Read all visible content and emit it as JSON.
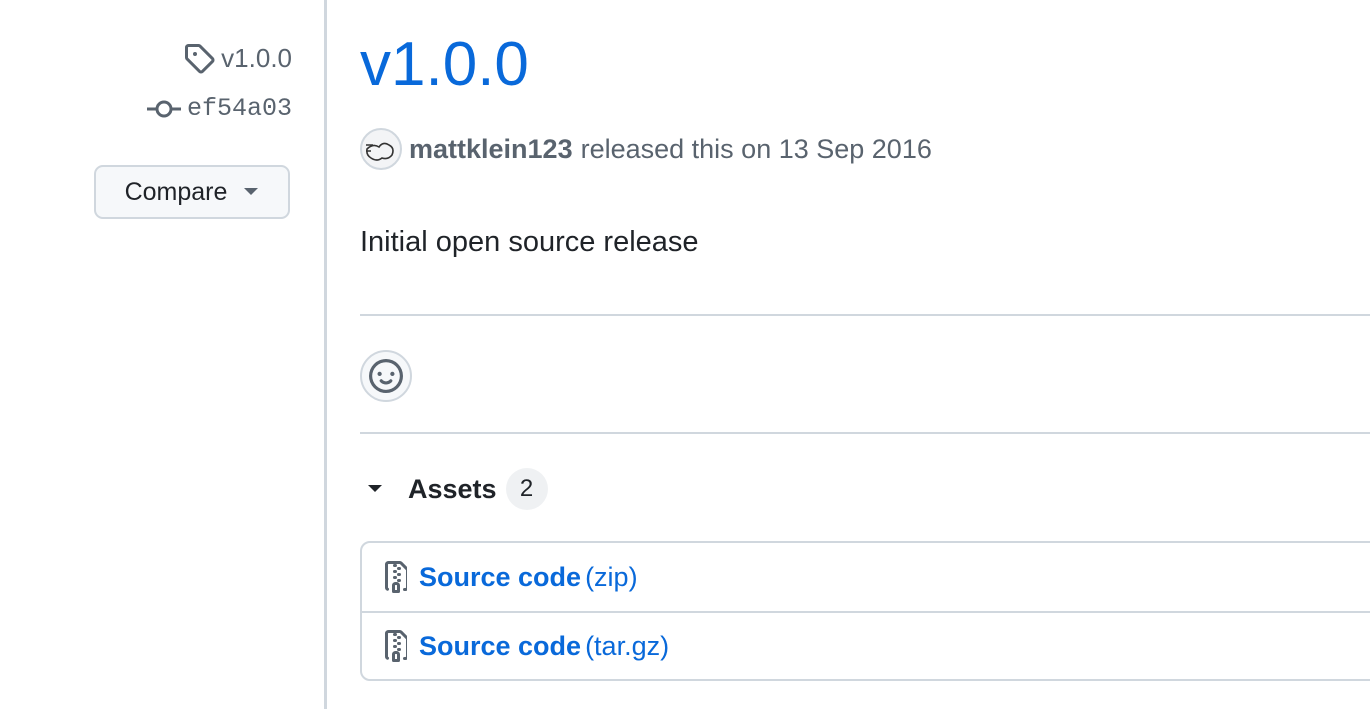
{
  "sidebar": {
    "tag": {
      "label": "v1.0.0",
      "icon": "tag-icon"
    },
    "commit": {
      "label": "ef54a03",
      "icon": "git-commit-icon"
    },
    "compare_button": {
      "label": "Compare",
      "icon": "triangle-down-icon"
    }
  },
  "release": {
    "title": "v1.0.0",
    "author": "mattklein123",
    "released_text": "released this on 13 Sep 2016",
    "notes": "Initial open source release"
  },
  "reactions": {
    "icon": "smiley-icon"
  },
  "assets": {
    "label": "Assets",
    "count": "2",
    "items": [
      {
        "name": "Source code",
        "ext": "(zip)",
        "icon": "file-zip-icon"
      },
      {
        "name": "Source code",
        "ext": "(tar.gz)",
        "icon": "file-zip-icon"
      }
    ]
  },
  "colors": {
    "link": "#0969da",
    "muted": "#59636e",
    "border": "#d0d7de",
    "text": "#1f2328"
  }
}
